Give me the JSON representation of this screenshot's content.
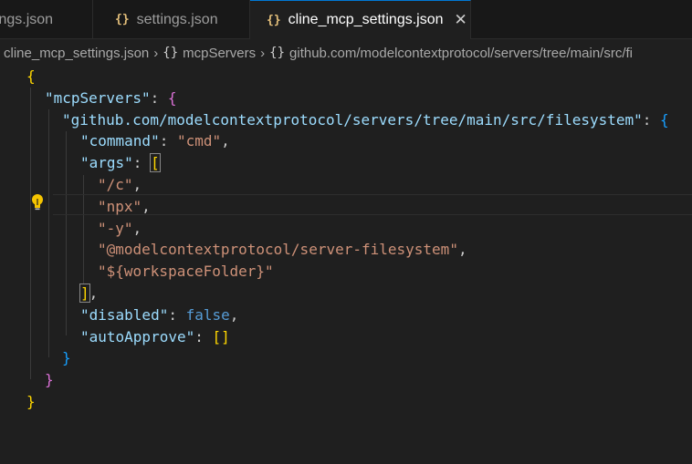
{
  "tabs": [
    {
      "label": "ttings.json",
      "active": false
    },
    {
      "label": "settings.json",
      "active": false
    },
    {
      "label": "cline_mcp_settings.json",
      "active": true
    }
  ],
  "tab_icon": "{}",
  "close_glyph": "✕",
  "breadcrumb": {
    "file": "cline_mcp_settings.json",
    "node1": "mcpServers",
    "node2": "github.com/modelcontextprotocol/servers/tree/main/src/fi",
    "icon": "{}"
  },
  "code": {
    "open_brace": "{",
    "close_brace": "}",
    "mcp_key": "\"mcpServers\"",
    "server_key": "\"github.com/modelcontextprotocol/servers/tree/main/src/filesystem\"",
    "command_key": "\"command\"",
    "command_val": "\"cmd\"",
    "args_key": "\"args\"",
    "args": [
      "\"/c\"",
      "\"npx\"",
      "\"-y\"",
      "\"@modelcontextprotocol/server-filesystem\"",
      "\"${workspaceFolder}\""
    ],
    "disabled_key": "\"disabled\"",
    "disabled_val": "false",
    "autoapprove_key": "\"autoApprove\"",
    "autoapprove_val": "[]",
    "open_bracket": "[",
    "close_bracket": "]"
  },
  "colors": {
    "editor_bg": "#1f1f1f",
    "key": "#9cdcfe",
    "string": "#ce9178",
    "bracket_l1": "#ffd700",
    "bracket_l2": "#da70d6",
    "bracket_l3": "#179fff",
    "keyword": "#569cd6",
    "accent": "#0078d4"
  }
}
